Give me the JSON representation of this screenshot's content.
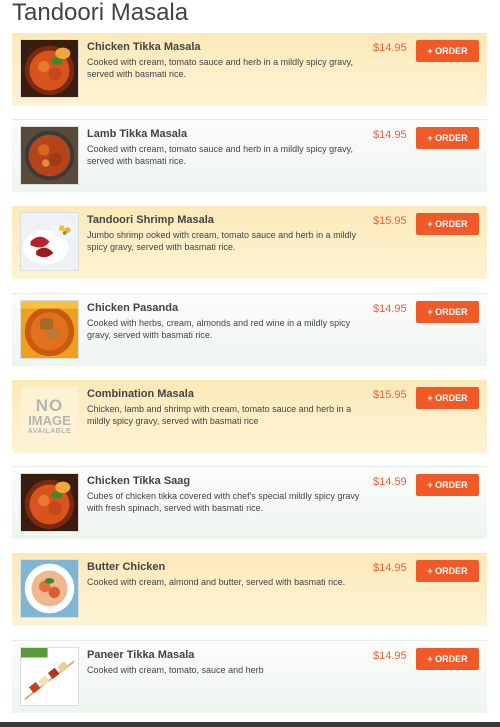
{
  "page": {
    "title": "Tandoori Masala"
  },
  "colors": {
    "accent": "#ef5a28",
    "price": "#e8613a",
    "warm_bg": "#fce9b9",
    "cool_bg": "#f4f8f4"
  },
  "items": [
    {
      "name": "Chicken Tikka Masala",
      "description": "Cooked with cream, tomato sauce and herb in a mildly spicy gravy, served with basmati rice.",
      "price": "$14.95",
      "order_label": "+ ORDER",
      "image": "curry-bowl"
    },
    {
      "name": "Lamb Tikka Masala",
      "description": "Cooked with cream, tomato sauce and herb in a mildly spicy gravy, served with basmati rice.",
      "price": "$14.95",
      "order_label": "+ ORDER",
      "image": "lamb-curry"
    },
    {
      "name": "Tandoori Shrimp Masala",
      "description": "Jumbo shrimp ooked with cream, tomato sauce and herb in a mildly spicy gravy, served with basmati rice.",
      "price": "$15.95",
      "order_label": "+ ORDER",
      "image": "shrimp-plate"
    },
    {
      "name": "Chicken Pasanda",
      "description": "Cooked with herbs, cream, almonds and red wine in a mildly spicy gravy, served with basmati rice.",
      "price": "$14.95",
      "order_label": "+ ORDER",
      "image": "pasanda-bowl"
    },
    {
      "name": "Combination Masala",
      "description": "Chicken, lamb and shrimp with cream, tomato sauce and herb in a mildly spicy gravy, served with basmati rice",
      "price": "$15.95",
      "order_label": "+ ORDER",
      "image": "no-image"
    },
    {
      "name": "Chicken Tikka Saag",
      "description": "Cubes of chicken tikka covered with chef's special mildly spicy gravy with fresh spinach, served with basmati rice.",
      "price": "$14.59",
      "order_label": "+ ORDER",
      "image": "curry-bowl"
    },
    {
      "name": "Butter Chicken",
      "description": "Cooked with cream, almond and butter, served with basmati rice.",
      "price": "$14.95",
      "order_label": "+ ORDER",
      "image": "butter-chicken"
    },
    {
      "name": "Paneer Tikka Masala",
      "description": "Cooked with cream, tomato, sauce and herb",
      "price": "$14.95",
      "order_label": "+ ORDER",
      "image": "paneer-skewers"
    }
  ],
  "no_image": {
    "line1": "NO",
    "line2": "IMAGE",
    "line3": "AVAILABLE"
  }
}
